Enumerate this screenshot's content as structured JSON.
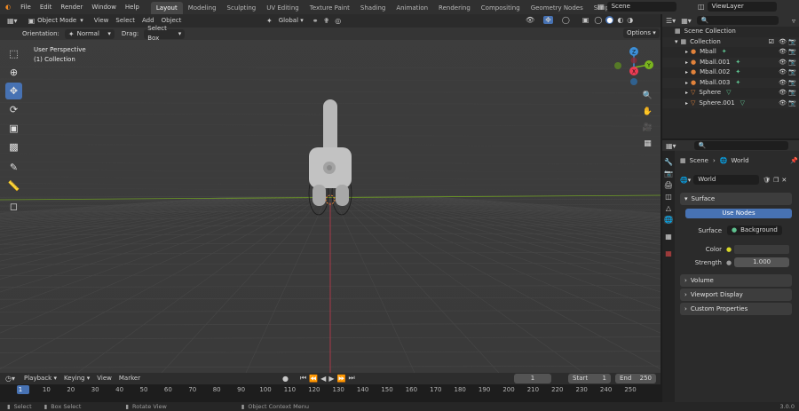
{
  "menu": [
    "File",
    "Edit",
    "Render",
    "Window",
    "Help"
  ],
  "workspaces": [
    "Layout",
    "Modeling",
    "Sculpting",
    "UV Editing",
    "Texture Paint",
    "Shading",
    "Animation",
    "Rendering",
    "Compositing",
    "Geometry Nodes",
    "Scripting"
  ],
  "active_workspace": "Layout",
  "scene": "Scene",
  "view_layer": "ViewLayer",
  "viewport": {
    "mode": "Object Mode",
    "header_menu": [
      "View",
      "Select",
      "Add",
      "Object"
    ],
    "transform_orientation": "Global",
    "options": "Options",
    "tool_settings": {
      "orientation_label": "Orientation:",
      "orientation_value": "Normal",
      "drag_label": "Drag:",
      "drag_value": "Select Box"
    },
    "overlay_title": "User Perspective",
    "overlay_collection": "(1) Collection",
    "gizmo": {
      "z": "Z",
      "y": "Y",
      "x": "X"
    }
  },
  "timeline": {
    "menu": [
      "Playback",
      "Keying",
      "View",
      "Marker"
    ],
    "current_frame": "1",
    "start_label": "Start",
    "start": "1",
    "end_label": "End",
    "end": "250",
    "ruler": [
      "1",
      "10",
      "20",
      "30",
      "40",
      "50",
      "60",
      "70",
      "80",
      "90",
      "100",
      "110",
      "120",
      "130",
      "140",
      "150",
      "160",
      "170",
      "180",
      "190",
      "200",
      "210",
      "220",
      "230",
      "240",
      "250"
    ]
  },
  "statusbar": {
    "items": [
      "Select",
      "Box Select",
      "Rotate View",
      "Object Context Menu"
    ],
    "version": "3.0.0"
  },
  "outliner": {
    "root": "Scene Collection",
    "collection": "Collection",
    "items": [
      {
        "name": "Mball",
        "type": "meta"
      },
      {
        "name": "Mball.001",
        "type": "meta"
      },
      {
        "name": "Mball.002",
        "type": "meta"
      },
      {
        "name": "Mball.003",
        "type": "meta"
      },
      {
        "name": "Sphere",
        "type": "mesh"
      },
      {
        "name": "Sphere.001",
        "type": "mesh"
      }
    ]
  },
  "properties": {
    "breadcrumb_scene": "Scene",
    "breadcrumb_world": "World",
    "world_name": "World",
    "panels": {
      "surface": "Surface",
      "use_nodes": "Use Nodes",
      "surface_label": "Surface",
      "surface_value": "Background",
      "color_label": "Color",
      "strength_label": "Strength",
      "strength_value": "1.000",
      "volume": "Volume",
      "viewport_display": "Viewport Display",
      "custom_properties": "Custom Properties"
    }
  },
  "colors": {
    "accent": "#4772b3",
    "x_axis": "#ed3b53",
    "y_axis": "#7ab51e",
    "z_axis": "#3c8fd8",
    "meta_icon": "#e2833b",
    "data_icon": "#5fc290",
    "color_swatch": "#d8d829"
  }
}
